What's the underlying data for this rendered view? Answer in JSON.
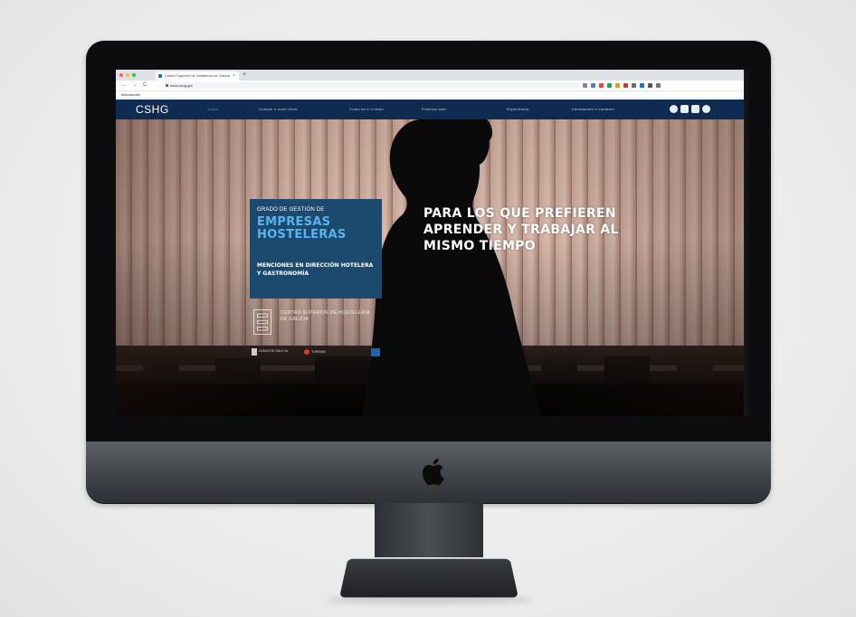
{
  "browser": {
    "tab_title": "Centro Superior de Hostelería de Galicia",
    "tab_close": "×",
    "new_tab": "+",
    "back": "←",
    "forward": "→",
    "reload": "C",
    "url": "www.cshg.gal",
    "bookmarks_label": "Marcadores"
  },
  "site": {
    "logo": "CSHG",
    "nav": [
      {
        "label": "Inicio",
        "active": true
      },
      {
        "label": "Conoce o novo título",
        "active": false
      },
      {
        "label": "Como se é o título",
        "active": false
      },
      {
        "label": "Práctica dual",
        "active": false
      },
      {
        "label": "Experiencia",
        "active": false
      },
      {
        "label": "Información e contacto",
        "active": false
      }
    ],
    "social_icons": [
      "facebook-icon",
      "linkedin-icon",
      "instagram-icon",
      "globe-icon"
    ],
    "accent": "#59b4ef",
    "nav_bg": "#0f2b52"
  },
  "hero": {
    "kicker": "GRADO DE GESTIÓN DE",
    "title_line1": "EMPRESAS",
    "title_line2": "HOSTELERAS",
    "subtitle": "MENCIONES EN DIRECCIÓN HOTELERA Y GASTRONOMÍA",
    "institution": "CENTRO SUPERIOR DE HOSTELERÍA DE GALICIA",
    "partner1": "XUNTA DE GALICIA",
    "partner2": "TURISMO",
    "headline": "PARA LOS QUE PREFIEREN APRENDER Y TRABAJAR AL MISMO TIEMPO"
  }
}
